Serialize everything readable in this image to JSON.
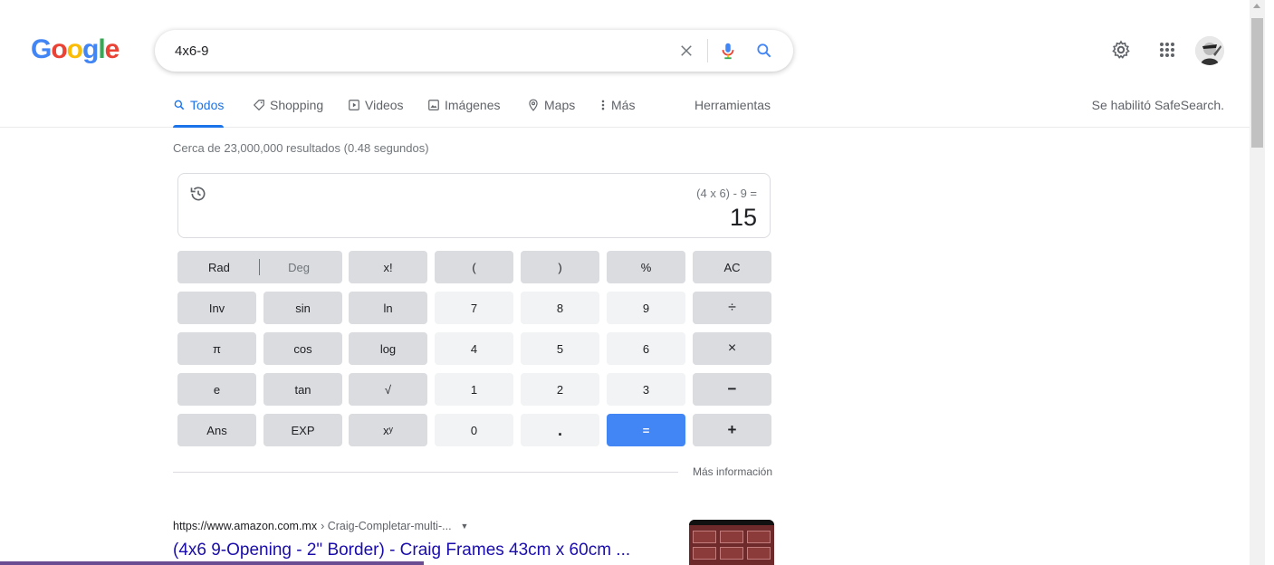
{
  "logo": {
    "letters": [
      "G",
      "o",
      "o",
      "g",
      "l",
      "e"
    ]
  },
  "search": {
    "query": "4x6-9"
  },
  "header_icons": {
    "settings": "gear-icon",
    "apps": "apps-grid-icon",
    "avatar": "avatar"
  },
  "tabs": [
    {
      "label": "Todos",
      "icon": "search-icon",
      "active": true
    },
    {
      "label": "Shopping",
      "icon": "tag-icon"
    },
    {
      "label": "Videos",
      "icon": "video-icon"
    },
    {
      "label": "Imágenes",
      "icon": "image-icon"
    },
    {
      "label": "Maps",
      "icon": "map-pin-icon"
    },
    {
      "label": "Más",
      "icon": "more-vert-icon"
    }
  ],
  "tools_label": "Herramientas",
  "safesearch": "Se habilitó SafeSearch.",
  "result_stats": "Cerca de 23,000,000 resultados (0.48 segundos)",
  "calculator": {
    "expression": "(4 x 6) - 9 =",
    "result": "15",
    "rad": "Rad",
    "deg": "Deg",
    "keys": {
      "fact": "x!",
      "lparen": "(",
      "rparen": ")",
      "percent": "%",
      "ac": "AC",
      "inv": "Inv",
      "sin": "sin",
      "ln": "ln",
      "seven": "7",
      "eight": "8",
      "nine": "9",
      "divide": "÷",
      "pi": "π",
      "cos": "cos",
      "log": "log",
      "four": "4",
      "five": "5",
      "six": "6",
      "multiply": "×",
      "e": "e",
      "tan": "tan",
      "sqrt": "√",
      "one": "1",
      "two": "2",
      "three": "3",
      "minus": "−",
      "ans": "Ans",
      "exp": "EXP",
      "power": "xʸ",
      "zero": "0",
      "dot": ".",
      "equals": "=",
      "plus": "+"
    },
    "more_info": "Más información"
  },
  "result_item": {
    "domain": "https://www.amazon.com.mx",
    "path": "› Craig-Completar-multi-...",
    "menu": "▼",
    "title": "(4x6 9-Opening - 2\" Border) - Craig Frames 43cm x 60cm ..."
  },
  "colors": {
    "accent": "#1a73e8",
    "link": "#1a0dab",
    "equals_key": "#4285f4"
  }
}
